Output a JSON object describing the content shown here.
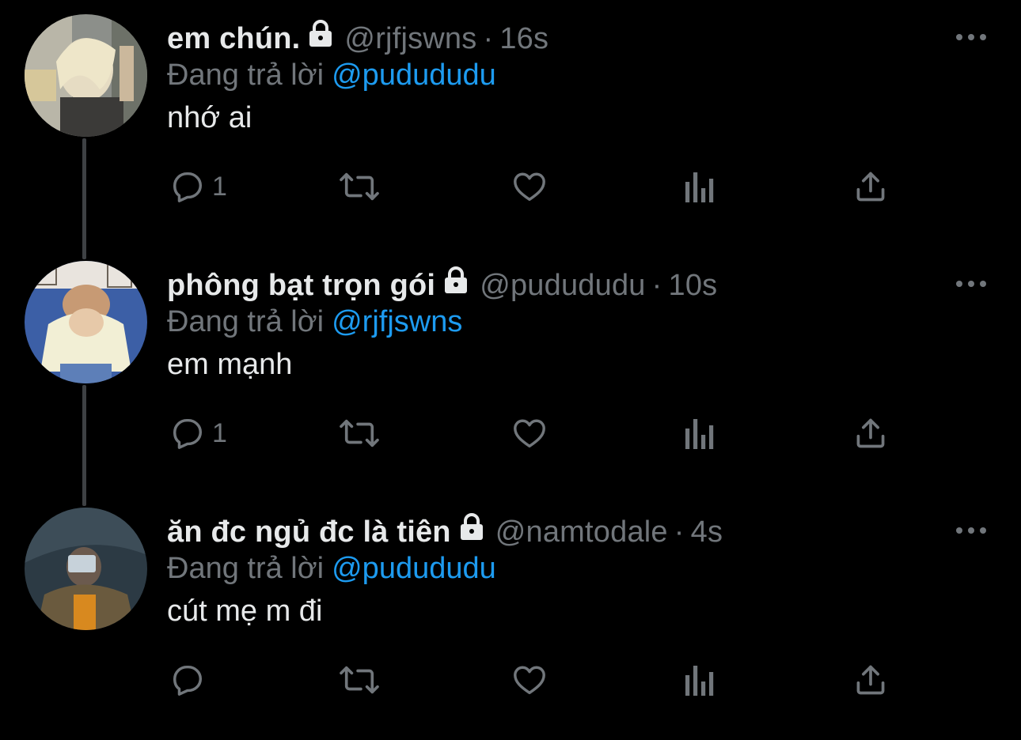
{
  "replying_label": "Đang trả lời",
  "tweets": [
    {
      "name": "em chún.",
      "handle": "@rjfjswns",
      "separator": "·",
      "time": "16s",
      "replying_to": "@pudududu",
      "text": "nhớ ai",
      "reply_count": "1",
      "protected": true
    },
    {
      "name": "phông bạt trọn gói",
      "handle": "@pudududu",
      "separator": "·",
      "time": "10s",
      "replying_to": "@rjfjswns",
      "text": "em mạnh",
      "reply_count": "1",
      "protected": true
    },
    {
      "name": "ăn đc ngủ đc là tiên",
      "handle": "@namtodale",
      "separator": "·",
      "time": "4s",
      "replying_to": "@pudududu",
      "text": "cút mẹ m đi",
      "reply_count": "",
      "protected": true
    }
  ],
  "icons": {
    "reply": "reply-icon",
    "retweet": "retweet-icon",
    "like": "heart-icon",
    "analytics": "analytics-icon",
    "share": "share-icon",
    "more": "more-icon",
    "protected": "lock-icon"
  },
  "colors": {
    "background": "#000000",
    "text": "#e7e9ea",
    "secondary": "#71767b",
    "mention": "#1d9bf0",
    "thread_line": "#3e4144"
  }
}
